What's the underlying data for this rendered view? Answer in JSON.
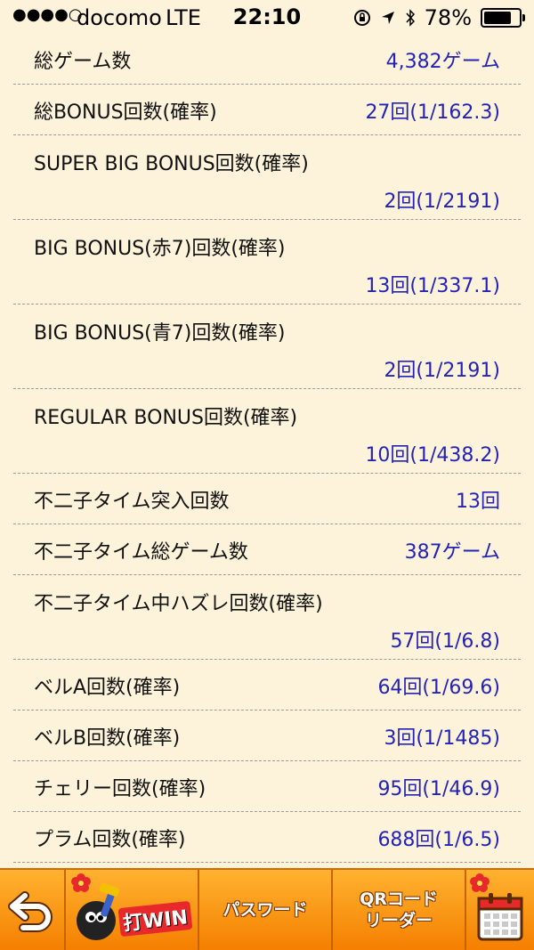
{
  "status_bar": {
    "signal": "●●●●○",
    "carrier": "docomo",
    "network": "LTE",
    "time": "22:10",
    "battery": "78%",
    "battery_level": 0.78
  },
  "rows": [
    {
      "label": "総ゲーム数",
      "value": "4,382ゲーム",
      "layout": "single"
    },
    {
      "label": "総BONUS回数(確率)",
      "value": "27回(1/162.3)",
      "layout": "single"
    },
    {
      "label": "SUPER BIG BONUS回数(確率)",
      "value": "2回(1/2191)",
      "layout": "double"
    },
    {
      "label": "BIG BONUS(赤7)回数(確率)",
      "value": "13回(1/337.1)",
      "layout": "double"
    },
    {
      "label": "BIG BONUS(青7)回数(確率)",
      "value": "2回(1/2191)",
      "layout": "double"
    },
    {
      "label": "REGULAR BONUS回数(確率)",
      "value": "10回(1/438.2)",
      "layout": "double"
    },
    {
      "label": "不二子タイム突入回数",
      "value": "13回",
      "layout": "single"
    },
    {
      "label": "不二子タイム総ゲーム数",
      "value": "387ゲーム",
      "layout": "single"
    },
    {
      "label": "不二子タイム中ハズレ回数(確率)",
      "value": "57回(1/6.8)",
      "layout": "double"
    },
    {
      "label": "ベルA回数(確率)",
      "value": "64回(1/69.6)",
      "layout": "single"
    },
    {
      "label": "ベルB回数(確率)",
      "value": "3回(1/1485)",
      "layout": "single"
    },
    {
      "label": "チェリー回数(確率)",
      "value": "95回(1/46.9)",
      "layout": "single"
    },
    {
      "label": "プラム回数(確率)",
      "value": "688回(1/6.5)",
      "layout": "single"
    }
  ],
  "toolbar": {
    "back_icon": "back-arrow-icon",
    "logo_text": "打WIN",
    "password_label": "パスワード",
    "qr_label_line1": "QRコード",
    "qr_label_line2": "リーダー",
    "calendar_icon": "calendar-icon"
  },
  "colors": {
    "background": "#fdf3da",
    "value_text": "#2323b8",
    "toolbar": "#f57f00"
  }
}
